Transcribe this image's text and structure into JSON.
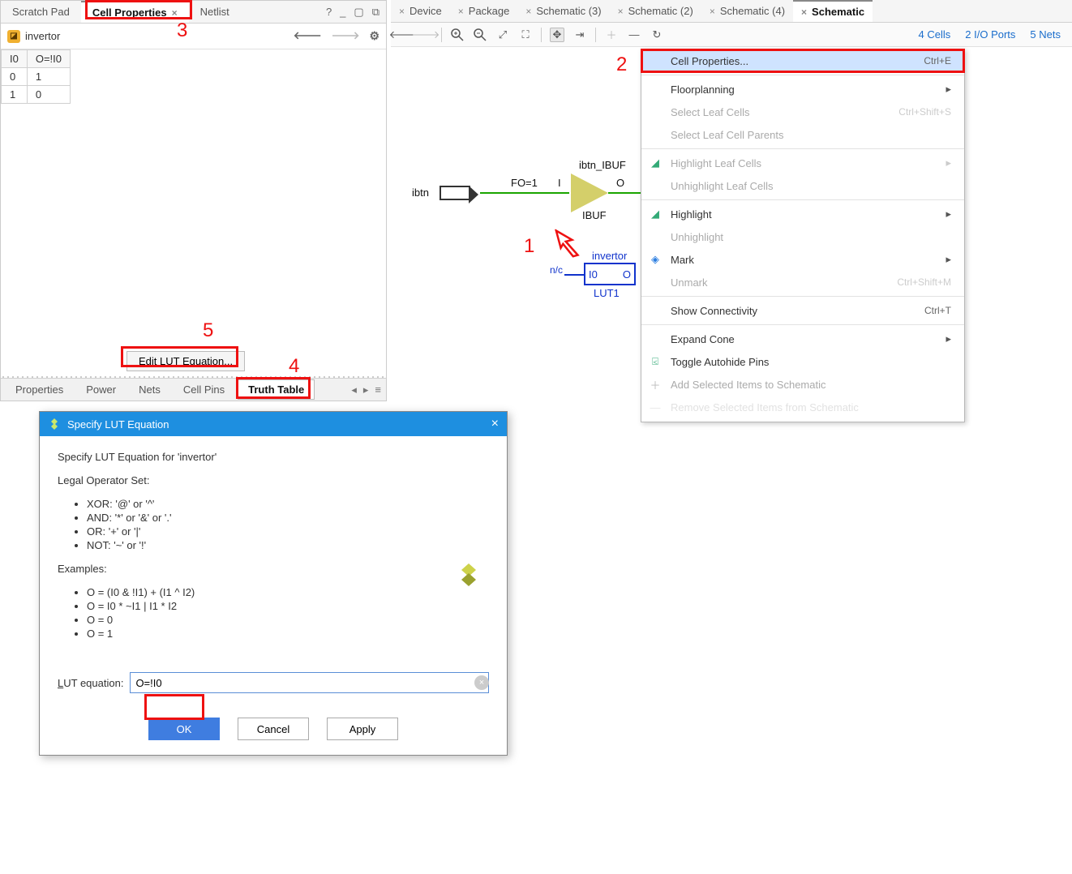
{
  "left": {
    "tabs": {
      "scratch": "Scratch Pad",
      "cellprops": "Cell Properties",
      "netlist": "Netlist"
    },
    "title": "invertor",
    "truth": {
      "headers": [
        "I0",
        "O=!I0"
      ],
      "rows": [
        [
          "0",
          "1"
        ],
        [
          "1",
          "0"
        ]
      ]
    },
    "editLut": "Edit LUT Equation...",
    "bottomTabs": {
      "properties": "Properties",
      "power": "Power",
      "nets": "Nets",
      "cellpins": "Cell Pins",
      "truthtable": "Truth Table"
    }
  },
  "right": {
    "tabs": {
      "device": "Device",
      "package": "Package",
      "sch3": "Schematic (3)",
      "sch2": "Schematic (2)",
      "sch4": "Schematic (4)",
      "schematic": "Schematic"
    },
    "stats": {
      "cells": "4 Cells",
      "ports": "2 I/O Ports",
      "nets": "5 Nets"
    },
    "schem": {
      "ibtn": "ibtn",
      "fo": "FO=1",
      "I": "I",
      "O": "O",
      "ibtn_ibuf": "ibtn_IBUF",
      "ibuf": "IBUF",
      "invertor": "invertor",
      "nc": "n/c",
      "i0": "I0",
      "lut_o": "O",
      "lut1": "LUT1"
    }
  },
  "ctx": {
    "cellprops": "Cell Properties...",
    "cellprops_sc": "Ctrl+E",
    "floorplan": "Floorplanning",
    "selLeaf": "Select Leaf Cells",
    "selLeaf_sc": "Ctrl+Shift+S",
    "selLeafParents": "Select Leaf Cell Parents",
    "hiLeaf": "Highlight Leaf Cells",
    "unhiLeaf": "Unhighlight Leaf Cells",
    "highlight": "Highlight",
    "unhighlight": "Unhighlight",
    "mark": "Mark",
    "unmark": "Unmark",
    "unmark_sc": "Ctrl+Shift+M",
    "showconn": "Show Connectivity",
    "showconn_sc": "Ctrl+T",
    "expand": "Expand Cone",
    "toggle": "Toggle Autohide Pins",
    "addsel": "Add Selected Items to Schematic",
    "remove": "Remove Selected Items from Schematic"
  },
  "dlg": {
    "title": "Specify LUT Equation",
    "intro": "Specify LUT Equation for 'invertor'",
    "legal": "Legal Operator Set:",
    "op_xor": "XOR: '@' or '^'",
    "op_and": "AND: '*' or '&' or '.'",
    "op_or": "OR: '+' or '|'",
    "op_not": "NOT: '~' or '!'",
    "examples": "Examples:",
    "ex1": "O = (I0 & !I1) + (I1 ^ I2)",
    "ex2": "O = I0 * ~I1 | I1 * I2",
    "ex3": "O = 0",
    "ex4": "O = 1",
    "eq_label": "LUT equation:",
    "eq_value": "O=!I0",
    "ok": "OK",
    "cancel": "Cancel",
    "apply": "Apply"
  },
  "annot": {
    "n1": "1",
    "n2": "2",
    "n3": "3",
    "n4": "4",
    "n5": "5"
  }
}
